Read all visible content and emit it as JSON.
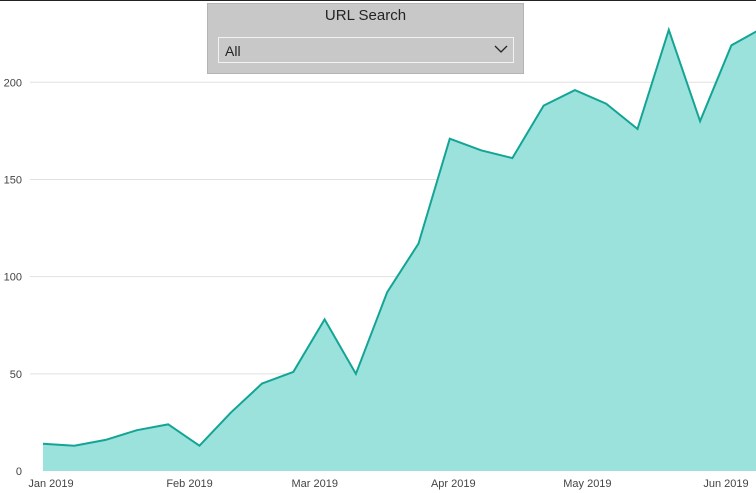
{
  "slicer": {
    "title": "URL Search",
    "selected": "All"
  },
  "colors": {
    "line": "#14a495",
    "fill": "#9ae2db",
    "gridline": "#e1e1e1",
    "slicer_bg": "#c8c8c8"
  },
  "chart_data": {
    "type": "area",
    "title": "",
    "xlabel": "",
    "ylabel": "",
    "ylim": [
      0,
      230
    ],
    "yticks": [
      0,
      50,
      100,
      150,
      200
    ],
    "ytick_labels": [
      "0",
      "50",
      "100",
      "150",
      "200"
    ],
    "grid": true,
    "legend": "none",
    "x_axis": {
      "start": "2019-01-01",
      "end": "2019-06-30",
      "ticks": [
        {
          "date": "2019-01-01",
          "label": "Jan 2019"
        },
        {
          "date": "2019-02-01",
          "label": "Feb 2019"
        },
        {
          "date": "2019-03-01",
          "label": "Mar 2019"
        },
        {
          "date": "2019-04-01",
          "label": "Apr 2019"
        },
        {
          "date": "2019-05-01",
          "label": "May 2019"
        },
        {
          "date": "2019-06-01",
          "label": "Jun 2019"
        }
      ]
    },
    "series": [
      {
        "points": [
          {
            "x": "2019-01-01",
            "y": 14
          },
          {
            "x": "2019-01-08",
            "y": 13
          },
          {
            "x": "2019-01-15",
            "y": 16
          },
          {
            "x": "2019-01-22",
            "y": 21
          },
          {
            "x": "2019-01-29",
            "y": 24
          },
          {
            "x": "2019-02-05",
            "y": 13
          },
          {
            "x": "2019-02-12",
            "y": 30
          },
          {
            "x": "2019-02-19",
            "y": 45
          },
          {
            "x": "2019-02-26",
            "y": 51
          },
          {
            "x": "2019-03-05",
            "y": 78
          },
          {
            "x": "2019-03-12",
            "y": 50
          },
          {
            "x": "2019-03-19",
            "y": 92
          },
          {
            "x": "2019-03-26",
            "y": 117
          },
          {
            "x": "2019-04-02",
            "y": 171
          },
          {
            "x": "2019-04-09",
            "y": 165
          },
          {
            "x": "2019-04-16",
            "y": 161
          },
          {
            "x": "2019-04-23",
            "y": 188
          },
          {
            "x": "2019-04-30",
            "y": 196
          },
          {
            "x": "2019-05-07",
            "y": 189
          },
          {
            "x": "2019-05-14",
            "y": 176
          },
          {
            "x": "2019-05-21",
            "y": 227
          },
          {
            "x": "2019-05-28",
            "y": 180
          },
          {
            "x": "2019-06-04",
            "y": 219
          },
          {
            "x": "2019-06-11",
            "y": 228
          },
          {
            "x": "2019-06-12",
            "y": 214
          }
        ]
      }
    ]
  }
}
